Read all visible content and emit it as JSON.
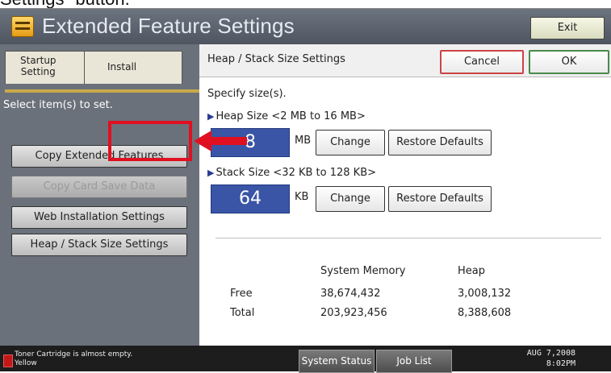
{
  "caption": "Settings\" button.",
  "titlebar": {
    "title": "Extended Feature Settings",
    "exit_label": "Exit"
  },
  "left_panel": {
    "tabs": [
      {
        "label_line1": "Startup",
        "label_line2": "Setting"
      },
      {
        "label": "Install"
      }
    ],
    "hint": "Select item(s) to set.",
    "buttons": [
      {
        "label": "Copy Extended Features"
      },
      {
        "label": "Copy Card Save Data",
        "disabled": true
      },
      {
        "label": "Web Installation Settings"
      },
      {
        "label": "Heap / Stack Size Settings"
      }
    ]
  },
  "main": {
    "title": "Heap / Stack Size Settings",
    "cancel_label": "Cancel",
    "ok_label": "OK",
    "specify": "Specify size(s).",
    "heap": {
      "label": "Heap Size <2 MB to 16 MB>",
      "value": "8",
      "unit": "MB",
      "change_label": "Change",
      "restore_label": "Restore Defaults"
    },
    "stack": {
      "label": "Stack Size <32 KB to 128 KB>",
      "value": "64",
      "unit": "KB",
      "change_label": "Change",
      "restore_label": "Restore Defaults"
    },
    "memory": {
      "col_system": "System Memory",
      "col_heap": "Heap",
      "rows": [
        {
          "label": "Free",
          "system": "38,674,432",
          "heap": "3,008,132"
        },
        {
          "label": "Total",
          "system": "203,923,456",
          "heap": "8,388,608"
        }
      ]
    }
  },
  "statusbar": {
    "toner_line1": "Toner Cartridge is almost empty.",
    "toner_line2": "Yellow",
    "system_status_label": "System Status",
    "job_list_label": "Job List",
    "date": "AUG  7,2008",
    "time": "8:02PM"
  },
  "colors": {
    "highlight": "#e01020",
    "value_box": "#3a55a5"
  }
}
